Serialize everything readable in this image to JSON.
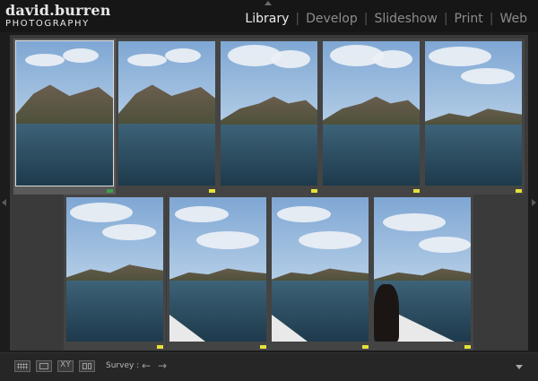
{
  "branding": {
    "line1": "david.burren",
    "line2": "PHOTOGRAPHY"
  },
  "modules": [
    {
      "label": "Library",
      "active": true
    },
    {
      "label": "Develop",
      "active": false
    },
    {
      "label": "Slideshow",
      "active": false
    },
    {
      "label": "Print",
      "active": false
    },
    {
      "label": "Web",
      "active": false
    }
  ],
  "photos": [
    {
      "scene": "mountains-close",
      "label_color": "#3ea04a",
      "selected": true
    },
    {
      "scene": "mountains-close",
      "label_color": "#e6e23a",
      "selected": false
    },
    {
      "scene": "mountains-mid",
      "label_color": "#e6e23a",
      "selected": false
    },
    {
      "scene": "mountains-mid",
      "label_color": "#e6e23a",
      "selected": false
    },
    {
      "scene": "mountains-far",
      "label_color": "#e6e23a",
      "selected": false
    },
    {
      "scene": "mountains-far",
      "label_color": "#e6e23a",
      "selected": false
    },
    {
      "scene": "boat-rail",
      "label_color": "#e6e23a",
      "selected": false
    },
    {
      "scene": "boat-rail",
      "label_color": "#e6e23a",
      "selected": false
    },
    {
      "scene": "boat-person",
      "label_color": "#e6e23a",
      "selected": false
    }
  ],
  "toolbar": {
    "view_icons": [
      "grid-view-icon",
      "loupe-view-icon",
      "compare-view-icon",
      "survey-view-icon"
    ],
    "compare_text": "XY",
    "mode_label": "Survey :",
    "prev_arrow": "←",
    "next_arrow": "→"
  },
  "colors": {
    "background": "#1c1c1c",
    "panel": "#3a3a3a",
    "accent_text": "#ececec"
  }
}
